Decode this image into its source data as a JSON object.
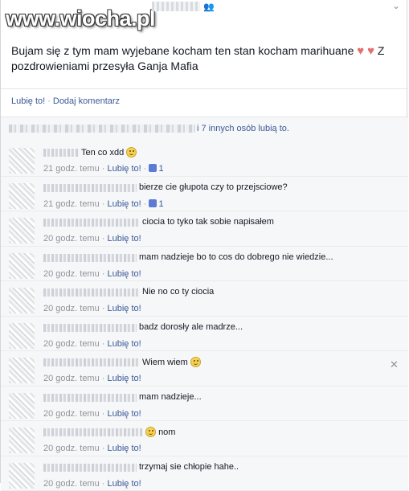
{
  "watermark": "www.wiocha.pl",
  "post": {
    "text_line1": "Bujam się z tym mam wyjebane kocham ten stan kocham marihuane",
    "text_line1_end": "Z",
    "text_line2": "pozdrowieniami przesyła Ganja Mafia",
    "heart1": "♥",
    "heart2": "♥"
  },
  "icons": {
    "friends": "👥",
    "chevron": "⌄",
    "close": "✕"
  },
  "actions": {
    "like": "Lubię to!",
    "separator": "·",
    "comment": "Dodaj komentarz"
  },
  "likes": {
    "text": "i 7 innych osób lubią to."
  },
  "comments": [
    {
      "text": "Ten co xdd",
      "emoji": true,
      "time": "21 godz. temu",
      "like": "Lubię to!",
      "likes": "1"
    },
    {
      "text": "bierze cie głupota czy to przejsciowe?",
      "emoji": false,
      "time": "21 godz. temu",
      "like": "Lubię to!",
      "likes": "1"
    },
    {
      "text": "ciocia to tyko tak sobie napisałem",
      "emoji": false,
      "time": "20 godz. temu",
      "like": "Lubię to!",
      "likes": ""
    },
    {
      "text": "mam nadzieje bo to cos do dobrego nie wiedzie...",
      "emoji": false,
      "time": "20 godz. temu",
      "like": "Lubię to!",
      "likes": ""
    },
    {
      "text": "Nie no co ty ciocia",
      "emoji": false,
      "time": "20 godz. temu",
      "like": "Lubię to!",
      "likes": ""
    },
    {
      "text": "badz dorosły ale madrze...",
      "emoji": false,
      "time": "20 godz. temu",
      "like": "Lubię to!",
      "likes": ""
    },
    {
      "text": "Wiem wiem",
      "emoji": true,
      "time": "20 godz. temu",
      "like": "Lubię to!",
      "likes": ""
    },
    {
      "text": "mam nadzieje...",
      "emoji": false,
      "time": "20 godz. temu",
      "like": "Lubię to!",
      "likes": ""
    },
    {
      "text": "nom",
      "emoji": true,
      "emoji_before": true,
      "time": "20 godz. temu",
      "like": "Lubię to!",
      "likes": ""
    },
    {
      "text": "trzymaj sie chłopie hahe..",
      "emoji": false,
      "time": "20 godz. temu",
      "like": "Lubię to!",
      "likes": ""
    }
  ]
}
